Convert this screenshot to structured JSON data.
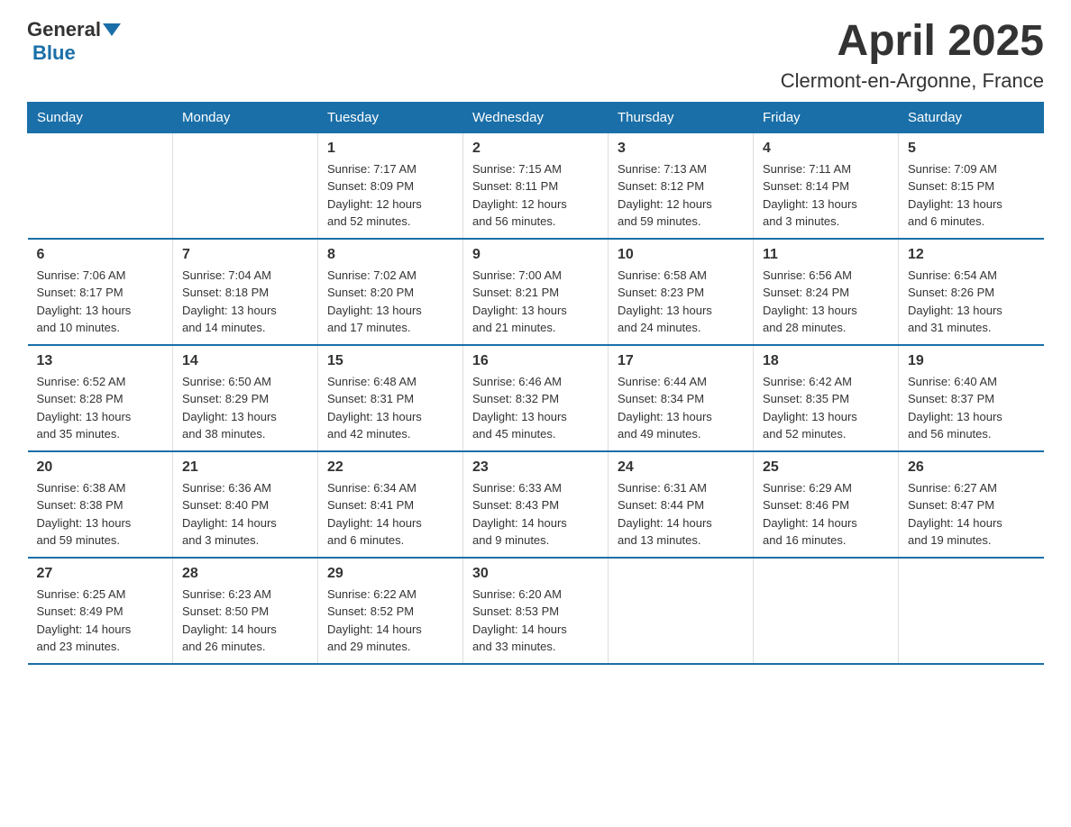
{
  "header": {
    "logo_general": "General",
    "logo_blue": "Blue",
    "title": "April 2025",
    "subtitle": "Clermont-en-Argonne, France"
  },
  "weekdays": [
    "Sunday",
    "Monday",
    "Tuesday",
    "Wednesday",
    "Thursday",
    "Friday",
    "Saturday"
  ],
  "weeks": [
    [
      {
        "day": "",
        "info": ""
      },
      {
        "day": "",
        "info": ""
      },
      {
        "day": "1",
        "info": "Sunrise: 7:17 AM\nSunset: 8:09 PM\nDaylight: 12 hours\nand 52 minutes."
      },
      {
        "day": "2",
        "info": "Sunrise: 7:15 AM\nSunset: 8:11 PM\nDaylight: 12 hours\nand 56 minutes."
      },
      {
        "day": "3",
        "info": "Sunrise: 7:13 AM\nSunset: 8:12 PM\nDaylight: 12 hours\nand 59 minutes."
      },
      {
        "day": "4",
        "info": "Sunrise: 7:11 AM\nSunset: 8:14 PM\nDaylight: 13 hours\nand 3 minutes."
      },
      {
        "day": "5",
        "info": "Sunrise: 7:09 AM\nSunset: 8:15 PM\nDaylight: 13 hours\nand 6 minutes."
      }
    ],
    [
      {
        "day": "6",
        "info": "Sunrise: 7:06 AM\nSunset: 8:17 PM\nDaylight: 13 hours\nand 10 minutes."
      },
      {
        "day": "7",
        "info": "Sunrise: 7:04 AM\nSunset: 8:18 PM\nDaylight: 13 hours\nand 14 minutes."
      },
      {
        "day": "8",
        "info": "Sunrise: 7:02 AM\nSunset: 8:20 PM\nDaylight: 13 hours\nand 17 minutes."
      },
      {
        "day": "9",
        "info": "Sunrise: 7:00 AM\nSunset: 8:21 PM\nDaylight: 13 hours\nand 21 minutes."
      },
      {
        "day": "10",
        "info": "Sunrise: 6:58 AM\nSunset: 8:23 PM\nDaylight: 13 hours\nand 24 minutes."
      },
      {
        "day": "11",
        "info": "Sunrise: 6:56 AM\nSunset: 8:24 PM\nDaylight: 13 hours\nand 28 minutes."
      },
      {
        "day": "12",
        "info": "Sunrise: 6:54 AM\nSunset: 8:26 PM\nDaylight: 13 hours\nand 31 minutes."
      }
    ],
    [
      {
        "day": "13",
        "info": "Sunrise: 6:52 AM\nSunset: 8:28 PM\nDaylight: 13 hours\nand 35 minutes."
      },
      {
        "day": "14",
        "info": "Sunrise: 6:50 AM\nSunset: 8:29 PM\nDaylight: 13 hours\nand 38 minutes."
      },
      {
        "day": "15",
        "info": "Sunrise: 6:48 AM\nSunset: 8:31 PM\nDaylight: 13 hours\nand 42 minutes."
      },
      {
        "day": "16",
        "info": "Sunrise: 6:46 AM\nSunset: 8:32 PM\nDaylight: 13 hours\nand 45 minutes."
      },
      {
        "day": "17",
        "info": "Sunrise: 6:44 AM\nSunset: 8:34 PM\nDaylight: 13 hours\nand 49 minutes."
      },
      {
        "day": "18",
        "info": "Sunrise: 6:42 AM\nSunset: 8:35 PM\nDaylight: 13 hours\nand 52 minutes."
      },
      {
        "day": "19",
        "info": "Sunrise: 6:40 AM\nSunset: 8:37 PM\nDaylight: 13 hours\nand 56 minutes."
      }
    ],
    [
      {
        "day": "20",
        "info": "Sunrise: 6:38 AM\nSunset: 8:38 PM\nDaylight: 13 hours\nand 59 minutes."
      },
      {
        "day": "21",
        "info": "Sunrise: 6:36 AM\nSunset: 8:40 PM\nDaylight: 14 hours\nand 3 minutes."
      },
      {
        "day": "22",
        "info": "Sunrise: 6:34 AM\nSunset: 8:41 PM\nDaylight: 14 hours\nand 6 minutes."
      },
      {
        "day": "23",
        "info": "Sunrise: 6:33 AM\nSunset: 8:43 PM\nDaylight: 14 hours\nand 9 minutes."
      },
      {
        "day": "24",
        "info": "Sunrise: 6:31 AM\nSunset: 8:44 PM\nDaylight: 14 hours\nand 13 minutes."
      },
      {
        "day": "25",
        "info": "Sunrise: 6:29 AM\nSunset: 8:46 PM\nDaylight: 14 hours\nand 16 minutes."
      },
      {
        "day": "26",
        "info": "Sunrise: 6:27 AM\nSunset: 8:47 PM\nDaylight: 14 hours\nand 19 minutes."
      }
    ],
    [
      {
        "day": "27",
        "info": "Sunrise: 6:25 AM\nSunset: 8:49 PM\nDaylight: 14 hours\nand 23 minutes."
      },
      {
        "day": "28",
        "info": "Sunrise: 6:23 AM\nSunset: 8:50 PM\nDaylight: 14 hours\nand 26 minutes."
      },
      {
        "day": "29",
        "info": "Sunrise: 6:22 AM\nSunset: 8:52 PM\nDaylight: 14 hours\nand 29 minutes."
      },
      {
        "day": "30",
        "info": "Sunrise: 6:20 AM\nSunset: 8:53 PM\nDaylight: 14 hours\nand 33 minutes."
      },
      {
        "day": "",
        "info": ""
      },
      {
        "day": "",
        "info": ""
      },
      {
        "day": "",
        "info": ""
      }
    ]
  ]
}
